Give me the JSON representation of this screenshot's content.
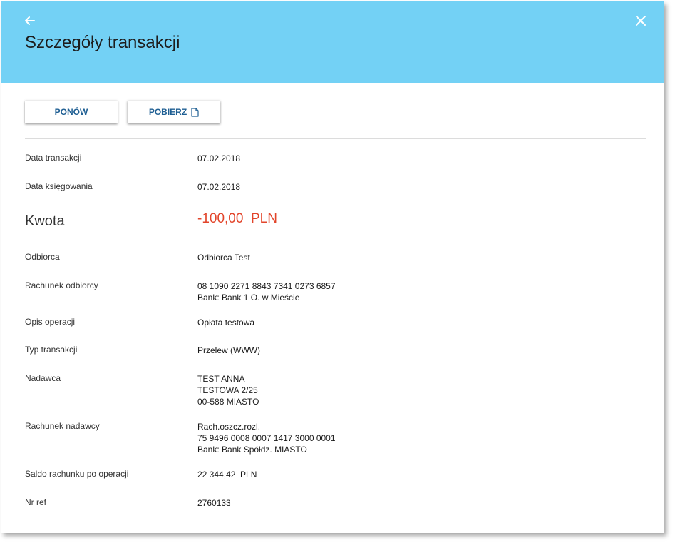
{
  "header": {
    "title": "Szczegóły transakcji",
    "back_icon": "arrow-left-icon",
    "close_icon": "close-icon",
    "color": "#73d1f5"
  },
  "actions": {
    "repeat_label": "PONÓW",
    "download_label": "POBIERZ",
    "download_icon": "document-icon",
    "label_color": "#1f5f93"
  },
  "details": {
    "transaction_date": {
      "label": "Data transakcji",
      "value": "07.02.2018"
    },
    "booking_date": {
      "label": "Data księgowania",
      "value": "07.02.2018"
    },
    "amount": {
      "label": "Kwota",
      "value": "-100,00  PLN",
      "color": "#e2452b"
    },
    "recipient": {
      "label": "Odbiorca",
      "value": "Odbiorca Test"
    },
    "recipient_account": {
      "label": "Rachunek odbiorcy",
      "line1": "08 1090 2271 8843 7341 0273 6857",
      "line2": "Bank: Bank 1 O. w Mieście"
    },
    "description": {
      "label": "Opis operacji",
      "value": "Opłata testowa"
    },
    "transaction_type": {
      "label": "Typ transakcji",
      "value": "Przelew (WWW)"
    },
    "sender": {
      "label": "Nadawca",
      "line1": "TEST ANNA",
      "line2": "TESTOWA 2/25",
      "line3": "00-588 MIASTO"
    },
    "sender_account": {
      "label": "Rachunek nadawcy",
      "line1": "Rach.oszcz.rozl.",
      "line2": "75 9496 0008 0007 1417 3000 0001",
      "line3": "Bank: Bank Spółdz. MIASTO"
    },
    "balance_after": {
      "label": "Saldo rachunku po operacji",
      "value": "22 344,42  PLN"
    },
    "reference": {
      "label": "Nr ref",
      "value": "2760133"
    }
  }
}
